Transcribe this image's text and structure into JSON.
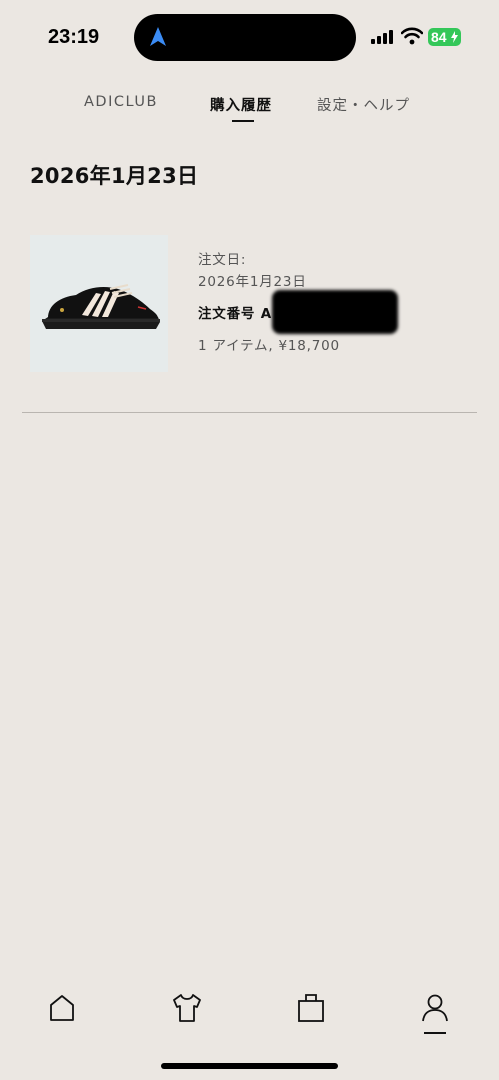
{
  "status_bar": {
    "time": "23:19",
    "battery": "84",
    "icons": [
      "navigation-arrow-icon",
      "cellular-signal-icon",
      "wifi-icon",
      "battery-icon"
    ]
  },
  "tabs": [
    {
      "label": "ADICLUB",
      "active": false
    },
    {
      "label": "購入履歴",
      "active": true
    },
    {
      "label": "設定・ヘルプ",
      "active": false
    }
  ],
  "order_group": {
    "date": "2026年1月23日",
    "order": {
      "date_label": "注文日:",
      "date_value": "2026年1月23日",
      "number_label": "注文番号 A",
      "summary": "1 アイテム, ¥18,700"
    }
  },
  "bottom_nav": {
    "items": [
      "home-icon",
      "shop-icon",
      "bag-icon",
      "account-icon"
    ],
    "active": "account-icon"
  },
  "colors": {
    "background": "#ebe7e2",
    "battery": "#34c759",
    "nav_arrow": "#3b8cf5",
    "divider": "#b9b5b0"
  }
}
